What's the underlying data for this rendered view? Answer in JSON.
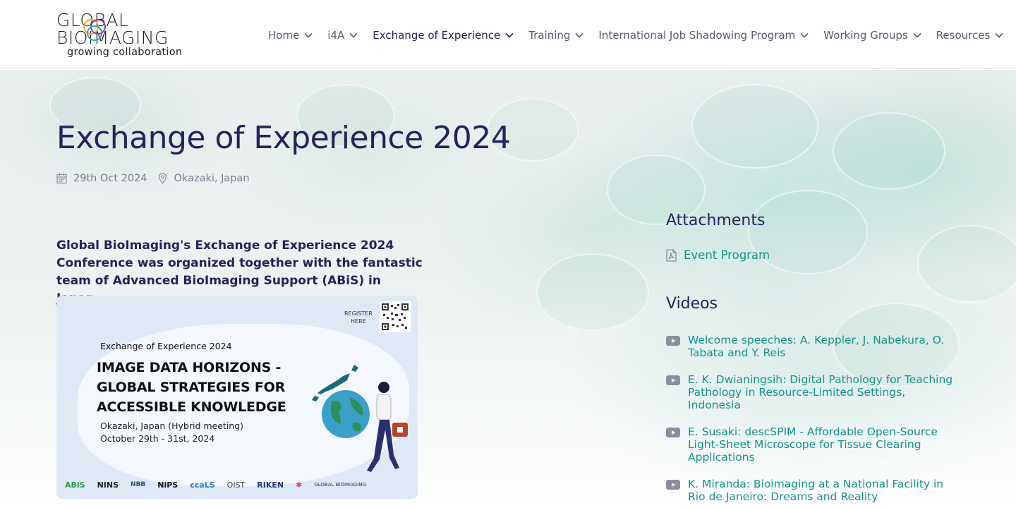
{
  "logo": {
    "line1": "GLOBAL",
    "line2": "BIOIMAGING",
    "line3": "growing collaboration"
  },
  "nav": [
    {
      "label": "Home"
    },
    {
      "label": "i4A"
    },
    {
      "label": "Exchange of Experience",
      "active": true
    },
    {
      "label": "Training"
    },
    {
      "label": "International Job Shadowing Program"
    },
    {
      "label": "Working Groups"
    },
    {
      "label": "Resources"
    }
  ],
  "page": {
    "title": "Exchange of Experience 2024",
    "date": "29th Oct 2024",
    "location": "Okazaki, Japan",
    "intro": "Global BioImaging's Exchange of Experience 2024 Conference was organized together with the fantastic team of Advanced BioImaging Support (ABiS) in Japan."
  },
  "poster": {
    "subtitle": "Exchange of Experience 2024",
    "headline1": "IMAGE DATA HORIZONS -",
    "headline2": "GLOBAL STRATEGIES FOR",
    "headline3": "ACCESSIBLE KNOWLEDGE",
    "place": "Okazaki, Japan (Hybrid meeting)",
    "dates": "October 29th - 31st, 2024",
    "register1": "REGISTER",
    "register2": "HERE",
    "logos": [
      "ABiS",
      "NINS",
      "NBB",
      "NiPS",
      "ccaLS",
      "OIST",
      "RIKEN",
      "✱",
      "GLOBAL BIOIMAGING"
    ]
  },
  "sidebar": {
    "attachments_heading": "Attachments",
    "attachment": "Event Program",
    "videos_heading": "Videos",
    "videos": [
      "Welcome speeches: A. Keppler, J. Nabekura, O. Tabata and Y. Reis",
      "E. K. Dwianingsih: Digital Pathology for Teaching Pathology in Resource-Limited Settings, Indonesia",
      "E. Susaki: descSPIM - Affordable Open-Source Light-Sheet Microscope for Tissue Clearing Applications",
      "K. Miranda: Bioimaging at a National Facility in Rio de Janeiro: Dreams and Reality"
    ]
  },
  "colors": {
    "accent": "#14928c",
    "heading": "#27225a",
    "nav": "#5b5b6e"
  },
  "icons": [
    "chevron-down-icon",
    "calendar-icon",
    "map-pin-icon",
    "pdf-file-icon",
    "video-play-icon"
  ]
}
